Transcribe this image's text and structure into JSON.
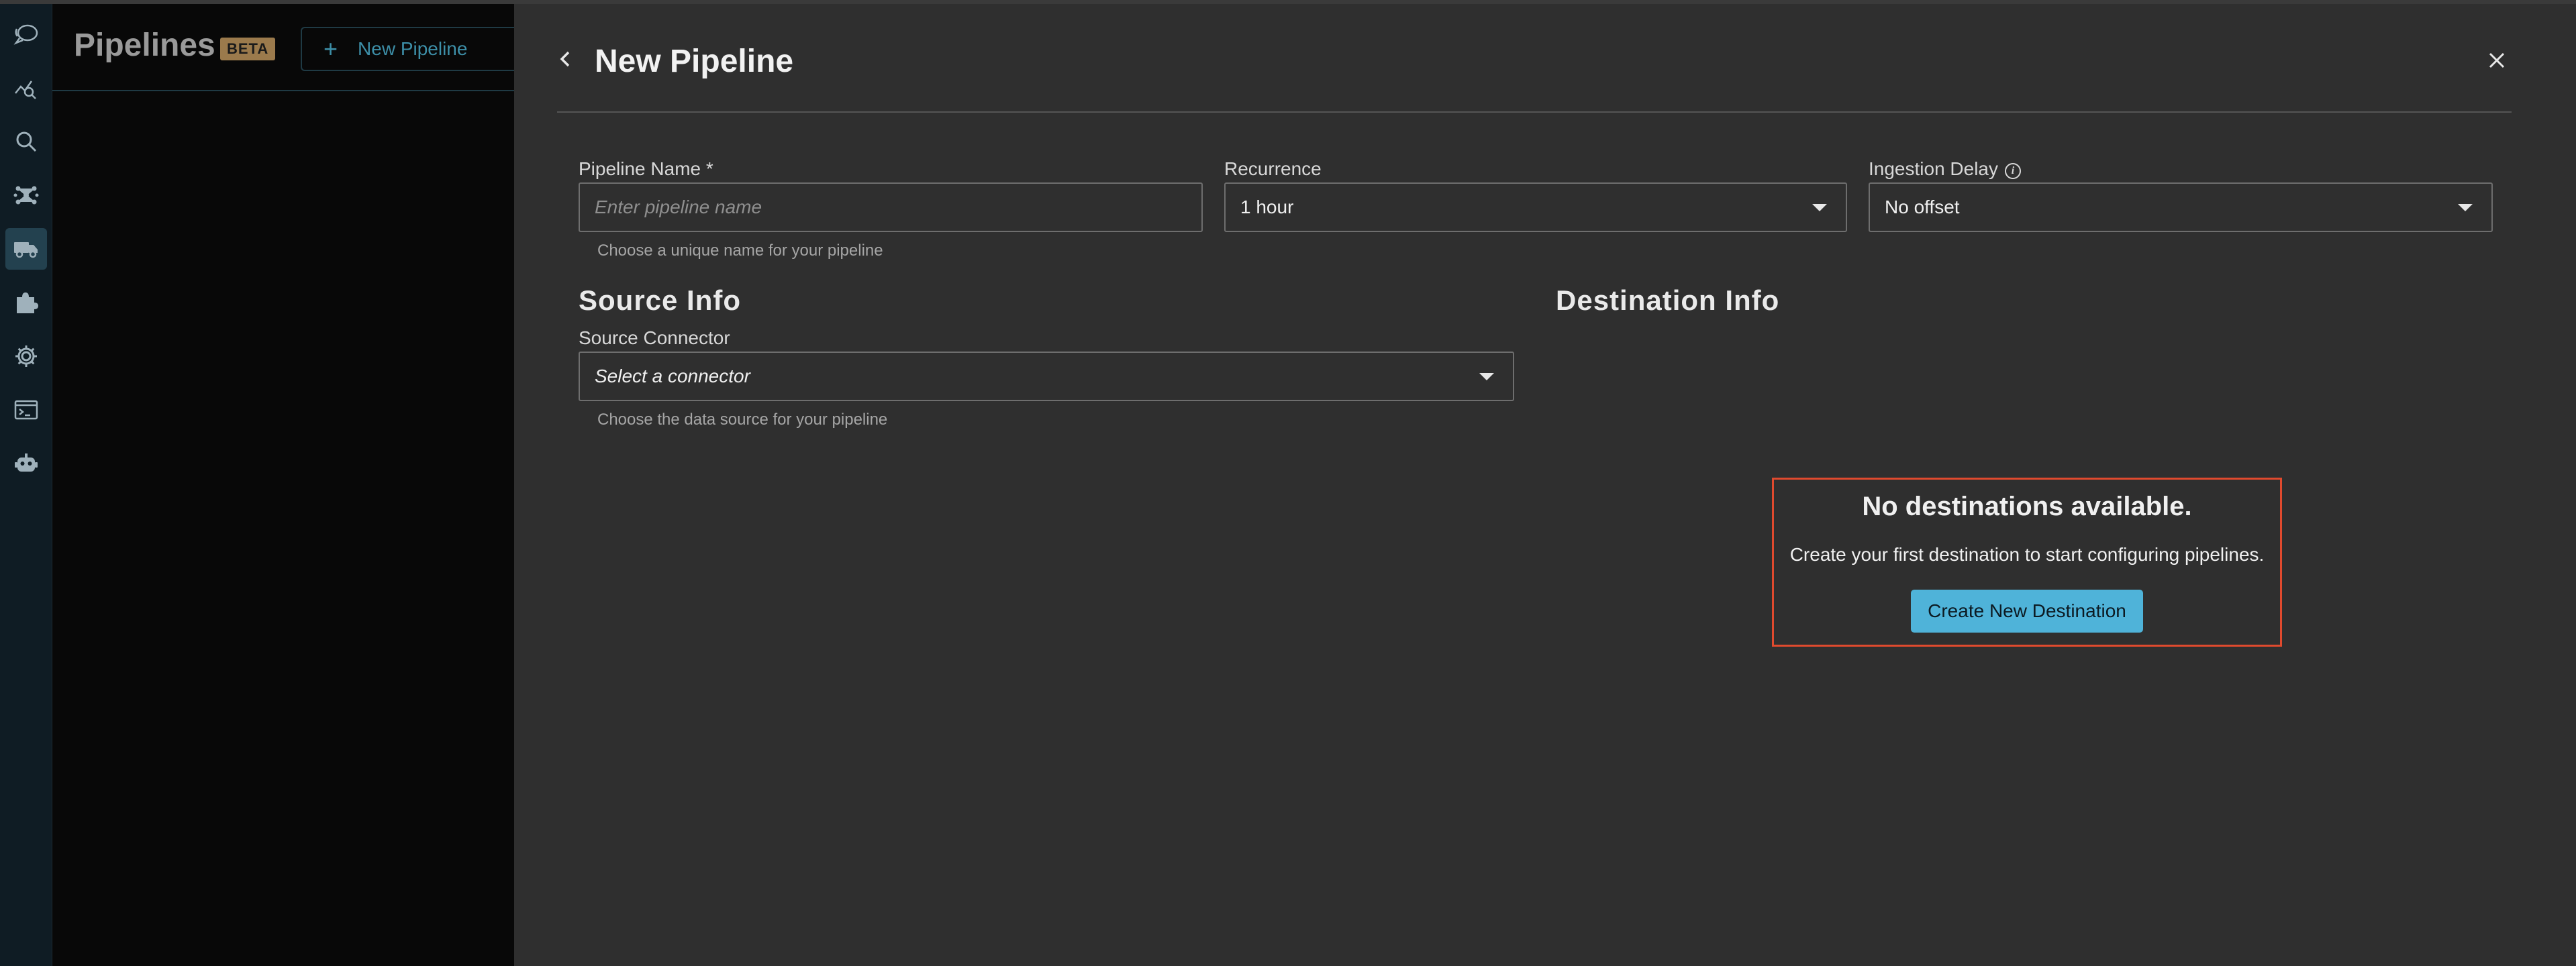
{
  "sidebar": {
    "icons": [
      "chat-icon",
      "analytics-icon",
      "search-icon",
      "cluster-icon",
      "truck-icon",
      "puzzle-icon",
      "gear-icon",
      "terminal-icon",
      "bot-icon"
    ],
    "active": "truck-icon"
  },
  "list": {
    "title": "Pipelines",
    "badge": "BETA",
    "new_button_label": "New Pipeline"
  },
  "modal": {
    "title": "New Pipeline",
    "pipeline_name": {
      "label": "Pipeline Name *",
      "placeholder": "Enter pipeline name",
      "value": "",
      "helper": "Choose a unique name for your pipeline"
    },
    "recurrence": {
      "label": "Recurrence",
      "value": "1 hour"
    },
    "ingestion_delay": {
      "label": "Ingestion Delay",
      "value": "No offset"
    },
    "source": {
      "section_title": "Source Info",
      "connector_label": "Source Connector",
      "connector_value": "Select a connector",
      "helper": "Choose the data source for your pipeline"
    },
    "destination": {
      "section_title": "Destination Info",
      "empty_title": "No destinations available.",
      "empty_text": "Create your first destination to start configuring pipelines.",
      "create_button_label": "Create New Destination"
    }
  },
  "colors": {
    "accent": "#4fb3d9",
    "highlight_border": "#e04a2e",
    "badge": "#9b7a4c",
    "panel_bg": "#2f2f2f"
  }
}
